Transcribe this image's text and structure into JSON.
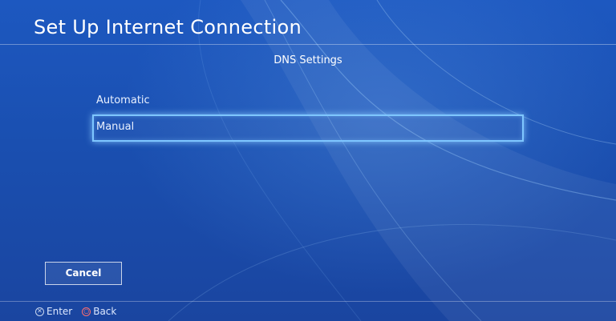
{
  "header": {
    "title": "Set Up Internet Connection"
  },
  "section": {
    "title": "DNS Settings"
  },
  "options": [
    {
      "label": "Automatic",
      "selected": false
    },
    {
      "label": "Manual",
      "selected": true
    }
  ],
  "cancel_button": {
    "label": "Cancel"
  },
  "footer": {
    "hints": [
      {
        "icon": "cross-button-icon",
        "label": "Enter"
      },
      {
        "icon": "circle-button-icon",
        "label": "Back"
      }
    ]
  },
  "colors": {
    "background": "#1b4fb3",
    "focus_outline": "#7ec6ff",
    "circle_button": "#ff6e6e"
  }
}
